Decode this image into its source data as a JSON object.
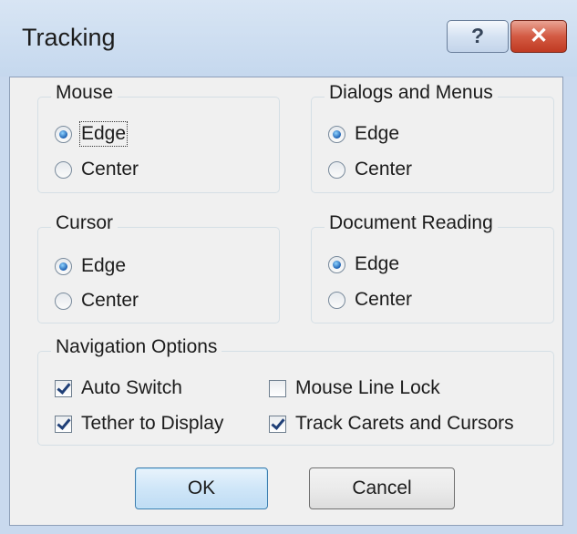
{
  "window": {
    "title": "Tracking",
    "help_glyph": "?",
    "close_glyph": "✕"
  },
  "groups": {
    "mouse": {
      "legend": "Mouse",
      "options": [
        "Edge",
        "Center"
      ],
      "selected": "Edge"
    },
    "dialogs": {
      "legend": "Dialogs and Menus",
      "options": [
        "Edge",
        "Center"
      ],
      "selected": "Edge"
    },
    "cursor": {
      "legend": "Cursor",
      "options": [
        "Edge",
        "Center"
      ],
      "selected": "Edge"
    },
    "reading": {
      "legend": "Document Reading",
      "options": [
        "Edge",
        "Center"
      ],
      "selected": "Edge"
    },
    "navigation": {
      "legend": "Navigation Options",
      "auto_switch": {
        "label": "Auto Switch",
        "checked": true
      },
      "mouse_line_lock": {
        "label": "Mouse Line Lock",
        "checked": false
      },
      "tether": {
        "label": "Tether to Display",
        "checked": true
      },
      "track_carets": {
        "label": "Track Carets and Cursors",
        "checked": true
      }
    }
  },
  "buttons": {
    "ok": "OK",
    "cancel": "Cancel"
  },
  "icons": {
    "help": "help-icon",
    "close": "close-icon"
  }
}
